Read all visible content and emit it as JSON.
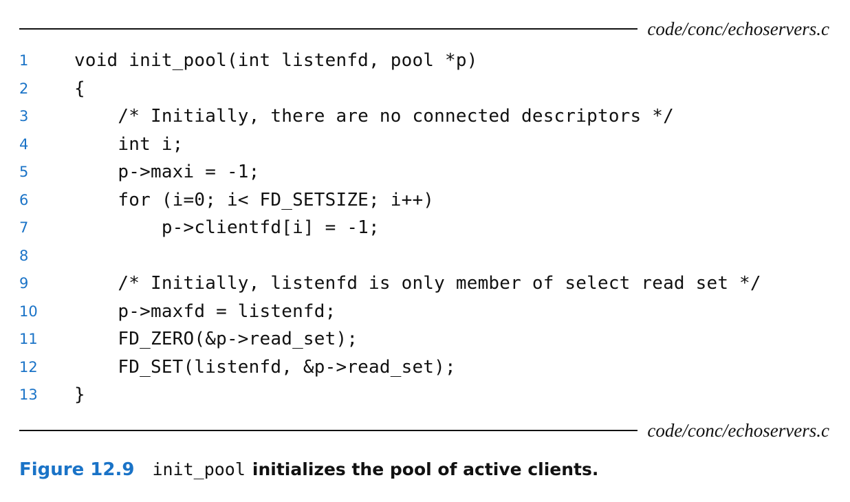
{
  "header": {
    "filename": "code/conc/echoservers.c"
  },
  "footer": {
    "filename": "code/conc/echoservers.c"
  },
  "code_lines": [
    {
      "num": "1",
      "text": "void init_pool(int listenfd, pool *p)"
    },
    {
      "num": "2",
      "text": "{"
    },
    {
      "num": "3",
      "text": "    /* Initially, there are no connected descriptors */"
    },
    {
      "num": "4",
      "text": "    int i;"
    },
    {
      "num": "5",
      "text": "    p->maxi = -1;"
    },
    {
      "num": "6",
      "text": "    for (i=0; i< FD_SETSIZE; i++)"
    },
    {
      "num": "7",
      "text": "        p->clientfd[i] = -1;"
    },
    {
      "num": "8",
      "text": ""
    },
    {
      "num": "9",
      "text": "    /* Initially, listenfd is only member of select read set */"
    },
    {
      "num": "10",
      "text": "    p->maxfd = listenfd;"
    },
    {
      "num": "11",
      "text": "    FD_ZERO(&p->read_set);"
    },
    {
      "num": "12",
      "text": "    FD_SET(listenfd, &p->read_set);"
    },
    {
      "num": "13",
      "text": "}"
    }
  ],
  "caption": {
    "label": "Figure 12.9",
    "code": "init_pool",
    "text": "initializes the pool of active clients."
  },
  "colors": {
    "accent": "#1a73c7",
    "text": "#111111"
  }
}
